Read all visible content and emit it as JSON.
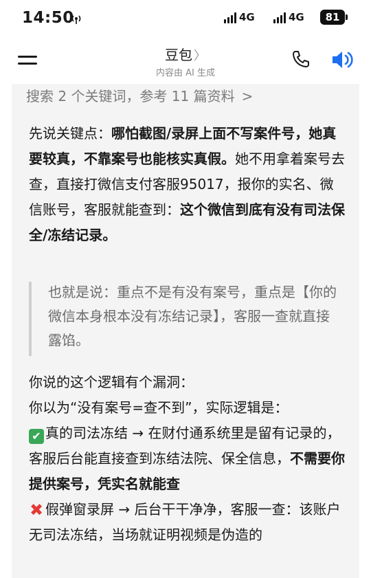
{
  "status_bar": {
    "time": "14:50",
    "net1": "4G",
    "net2": "4G",
    "battery": "81"
  },
  "nav": {
    "title": "豆包",
    "title_chevron": "〉",
    "subtitle": "内容由 AI 生成"
  },
  "icons": {
    "menu": "menu-icon",
    "phone": "phone-icon",
    "speaker": "speaker-icon",
    "hotspot": "hotspot-icon",
    "speaker_color": "#1e6ff2"
  },
  "message": {
    "search_summary": "搜索 2 个关键词，参考 11 篇资料",
    "search_chevron": ">",
    "p1": {
      "lead": "先说关键点：",
      "bold1": "哪怕截图/录屏上面不写案件号，她真要较真，不靠案号也能核实真假。",
      "text1": "她不用拿着案号去查，直接打微信支付客服95017，报你的实名、微信账号，客服就能查到：",
      "bold2": "这个微信到底有没有司法保全/冻结记录。"
    },
    "quote": "也就是说：重点不是有没有案号，重点是【你的微信本身根本没有冻结记录】，客服一查就直接露馅。",
    "p2": {
      "line1": "你说的这个逻辑有个漏洞：",
      "line2": "你以为“没有案号=查不到”，实际逻辑是：",
      "check_emoji": "✔",
      "check_text": "真的司法冻结 → 在财付通系统里是留有记录的，客服后台能直接查到冻结法院、保全信息，",
      "check_bold": "不需要你提供案号，凭实名就能查",
      "cross_emoji": "✖",
      "cross_text": "假弹窗录屏 → 后台干干净净，客服一查：该账户无司法冻结，当场就证明视频是伪造的"
    }
  }
}
